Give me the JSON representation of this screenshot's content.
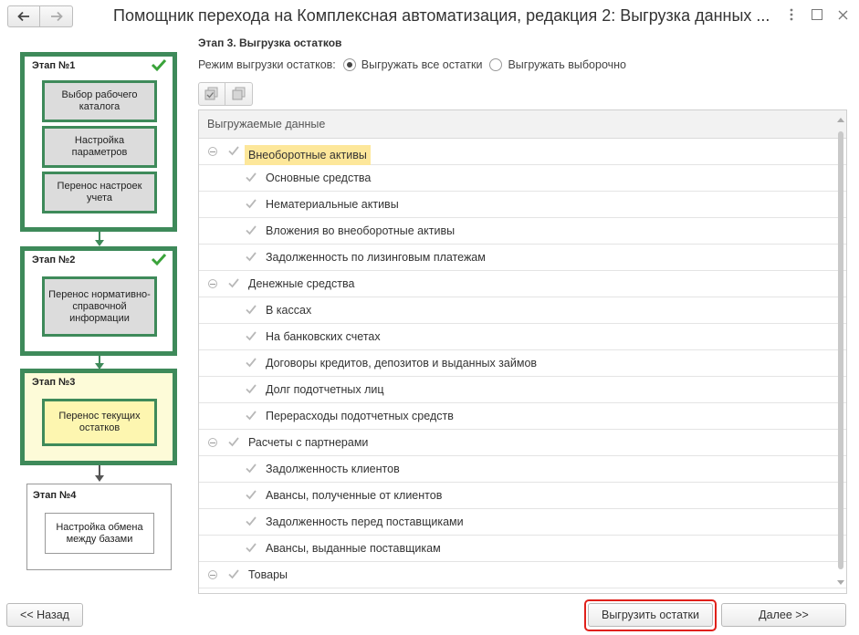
{
  "window": {
    "title": "Помощник перехода на Комплексная автоматизация, редакция 2: Выгрузка данных ...",
    "back_icon": "arrow-left-icon",
    "forward_icon": "arrow-right-icon",
    "menu_icon": "more-vertical-icon",
    "maximize_icon": "maximize-icon",
    "close_icon": "close-icon"
  },
  "stages": [
    {
      "title": "Этап №1",
      "status": "done",
      "steps": [
        "Выбор рабочего каталога",
        "Настройка параметров",
        "Перенос настроек учета"
      ]
    },
    {
      "title": "Этап №2",
      "status": "done",
      "steps": [
        "Перенос нормативно-справочной информации"
      ]
    },
    {
      "title": "Этап №3",
      "status": "current",
      "steps": [
        "Перенос текущих остатков"
      ]
    },
    {
      "title": "Этап №4",
      "status": "pending",
      "steps": [
        "Настройка обмена между базами"
      ]
    }
  ],
  "section_title": "Этап 3. Выгрузка остатков",
  "mode": {
    "label": "Режим выгрузки остатков:",
    "options": [
      "Выгружать все остатки",
      "Выгружать выборочно"
    ],
    "selected": "Выгружать все остатки"
  },
  "toolbar": {
    "check_all_icon": "check-all-icon",
    "uncheck_all_icon": "uncheck-all-icon"
  },
  "table": {
    "header": "Выгружаемые данные",
    "rows": [
      {
        "label": "Внеоборотные активы",
        "level": 0,
        "checked": true,
        "highlighted": true
      },
      {
        "label": "Основные средства",
        "level": 1,
        "checked": true
      },
      {
        "label": "Нематериальные активы",
        "level": 1,
        "checked": true
      },
      {
        "label": "Вложения во внеоборотные активы",
        "level": 1,
        "checked": true
      },
      {
        "label": "Задолженность по лизинговым платежам",
        "level": 1,
        "checked": true
      },
      {
        "label": "Денежные средства",
        "level": 0,
        "checked": true
      },
      {
        "label": "В кассах",
        "level": 1,
        "checked": true
      },
      {
        "label": "На банковских счетах",
        "level": 1,
        "checked": true
      },
      {
        "label": "Договоры кредитов, депозитов и выданных займов",
        "level": 1,
        "checked": true
      },
      {
        "label": "Долг подотчетных лиц",
        "level": 1,
        "checked": true
      },
      {
        "label": "Перерасходы подотчетных средств",
        "level": 1,
        "checked": true
      },
      {
        "label": "Расчеты с партнерами",
        "level": 0,
        "checked": true
      },
      {
        "label": "Задолженность клиентов",
        "level": 1,
        "checked": true
      },
      {
        "label": "Авансы, полученные от клиентов",
        "level": 1,
        "checked": true
      },
      {
        "label": "Задолженность перед поставщиками",
        "level": 1,
        "checked": true
      },
      {
        "label": "Авансы, выданные поставщикам",
        "level": 1,
        "checked": true
      },
      {
        "label": "Товары",
        "level": 0,
        "checked": true
      }
    ]
  },
  "buttons": {
    "back": "<< Назад",
    "export": "Выгрузить остатки",
    "next": "Далее >>"
  },
  "colors": {
    "stage_border": "#3e8a5a",
    "current_stage_bg": "#fdfbd8",
    "highlight": "#fde79a",
    "focus_ring": "#e0201a"
  }
}
